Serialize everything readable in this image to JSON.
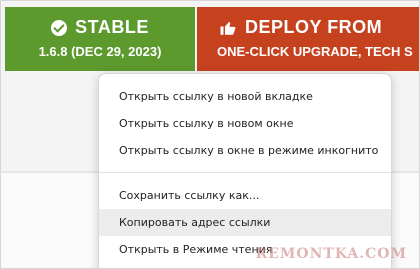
{
  "banners": {
    "stable": {
      "title": "STABLE",
      "subtitle": "1.6.8 (DEC 29, 2023)",
      "color": "#5c9a2e",
      "icon": "check-circle-icon"
    },
    "deploy": {
      "title": "DEPLOY FROM",
      "subtitle": "ONE-CLICK UPGRADE, TECH S",
      "color": "#c6421f",
      "icon": "thumbs-up-icon"
    }
  },
  "context_menu": {
    "items": [
      "Открыть ссылку в новой вкладке",
      "Открыть ссылку в новом окне",
      "Открыть ссылку в окне в режиме инкогнито",
      "Сохранить ссылку как...",
      "Копировать адрес ссылки",
      "Открыть в Режиме чтения"
    ],
    "hovered_index": 4
  },
  "watermark": "REMONTKA.COM"
}
